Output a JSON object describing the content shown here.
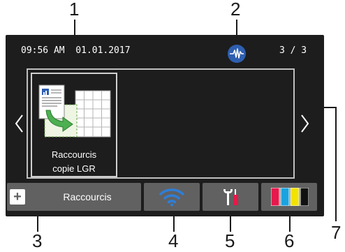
{
  "callouts": {
    "n1": "1",
    "n2": "2",
    "n3": "3",
    "n4": "4",
    "n5": "5",
    "n6": "6",
    "n7": "7"
  },
  "status_bar": {
    "datetime": "09:56 AM  01.01.2017",
    "page_indicator": "3 / 3",
    "network_icon": "network-status-icon"
  },
  "shortcut_tile": {
    "label_line1": "Raccourcis",
    "label_line2": "copie LGR",
    "icon": "copy-shortcut-icon"
  },
  "bottom_bar": {
    "shortcuts_label": "Raccourcis",
    "shortcuts_icon": "plus-icon",
    "wifi_icon": "wifi-icon",
    "settings_icon": "settings-tools-icon",
    "ink_icon": "ink-cartridges-icon",
    "ink_colors": [
      "#e5194b",
      "#1aa3e0",
      "#f2e300",
      "#111111"
    ]
  },
  "navigation": {
    "left_icon": "chevron-left-icon",
    "right_icon": "chevron-right-icon"
  }
}
